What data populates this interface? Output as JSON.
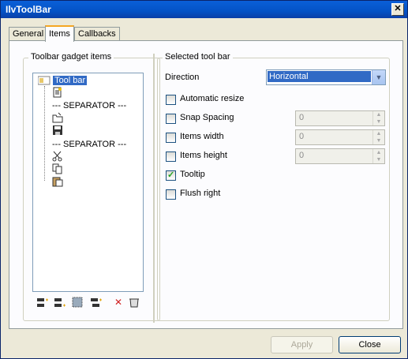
{
  "window": {
    "title": "IlvToolBar",
    "close_glyph": "✕"
  },
  "tabs": [
    {
      "label": "General",
      "active": false
    },
    {
      "label": "Items",
      "active": true
    },
    {
      "label": "Callbacks",
      "active": false
    }
  ],
  "left_group": {
    "title": "Toolbar gadget items",
    "tree": {
      "root_label": "Tool bar",
      "separators": [
        "--- SEPARATOR ---",
        "--- SEPARATOR ---"
      ]
    },
    "toolbar_icons": [
      "insert-before-icon",
      "insert-after-icon",
      "grid-icon",
      "insert-child-icon",
      "delete-icon",
      "trash-icon"
    ]
  },
  "right_group": {
    "title": "Selected tool bar",
    "direction_label": "Direction",
    "direction_value": "Horizontal",
    "options": {
      "automatic_resize": {
        "label": "Automatic resize",
        "checked": false
      },
      "snap_spacing": {
        "label": "Snap Spacing",
        "checked": false,
        "value": "0"
      },
      "items_width": {
        "label": "Items width",
        "checked": false,
        "value": "0"
      },
      "items_height": {
        "label": "Items height",
        "checked": false,
        "value": "0"
      },
      "tooltip": {
        "label": "Tooltip",
        "checked": true
      },
      "flush_right": {
        "label": "Flush right",
        "checked": false
      }
    }
  },
  "footer": {
    "apply_label": "Apply",
    "close_label": "Close"
  }
}
